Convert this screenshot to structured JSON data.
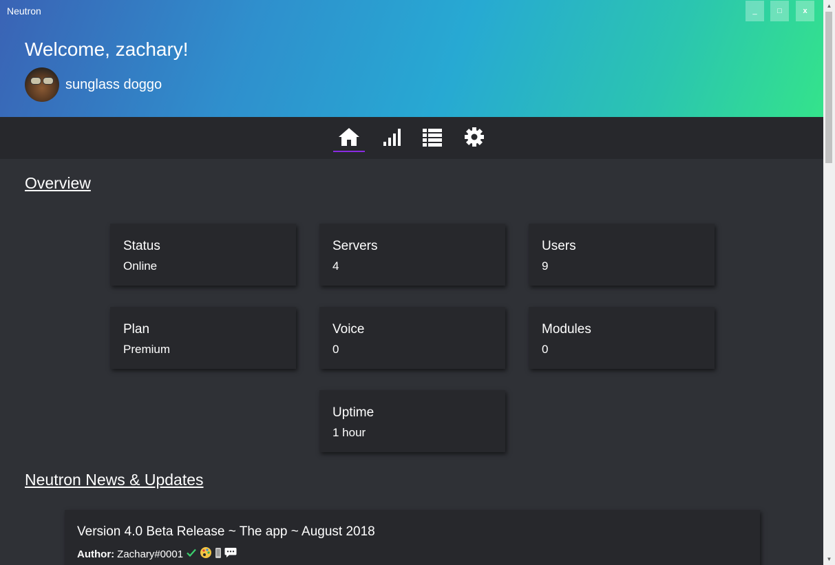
{
  "window": {
    "title": "Neutron",
    "minimize_label": "_",
    "maximize_label": "□",
    "close_label": "x"
  },
  "header": {
    "welcome": "Welcome, zachary!",
    "username": "sunglass doggo"
  },
  "nav": {
    "tabs": [
      {
        "icon": "home-icon",
        "active": true
      },
      {
        "icon": "stats-icon",
        "active": false
      },
      {
        "icon": "list-icon",
        "active": false
      },
      {
        "icon": "gear-icon",
        "active": false
      }
    ],
    "accent": "#8a2be2"
  },
  "overview": {
    "title": "Overview",
    "cards": [
      {
        "label": "Status",
        "value": "Online"
      },
      {
        "label": "Servers",
        "value": "4"
      },
      {
        "label": "Users",
        "value": "9"
      },
      {
        "label": "Plan",
        "value": "Premium"
      },
      {
        "label": "Voice",
        "value": "0"
      },
      {
        "label": "Modules",
        "value": "0"
      },
      {
        "label": "Uptime",
        "value": "1 hour"
      }
    ]
  },
  "news": {
    "title": "Neutron News & Updates",
    "posts": [
      {
        "title": "Version 4.0 Beta Release ~ The app ~ August 2018",
        "author_label": "Author:",
        "author": "Zachary#0001",
        "badges": [
          "check-icon",
          "palette-icon",
          "phone-icon",
          "chat-icon"
        ]
      }
    ]
  },
  "colors": {
    "background": "#2f3136",
    "card": "#27282c",
    "navbar": "#27282c"
  }
}
